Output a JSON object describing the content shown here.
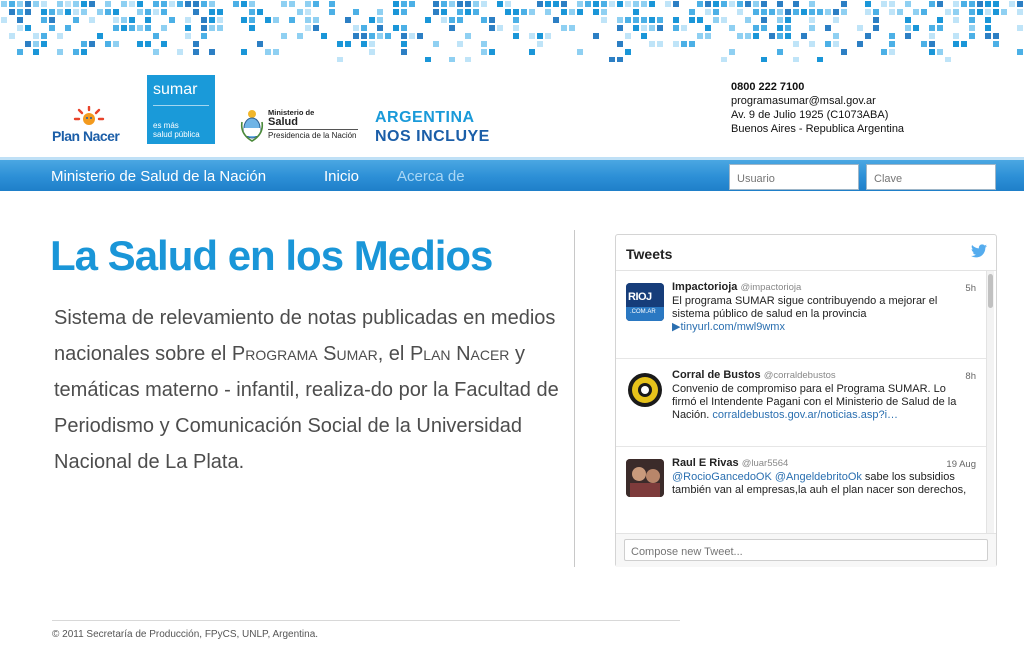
{
  "logos": {
    "plan_nacer": "Plan Nacer",
    "sumar": {
      "word": "sumar",
      "tag_line1": "es más",
      "tag_line2": "salud pública"
    },
    "ministerio": {
      "line1": "Ministerio de",
      "line2": "Salud",
      "line3": "Presidencia de la Nación"
    },
    "argentina": {
      "line1": "ARGENTINA",
      "line2": "NOS INCLUYE"
    }
  },
  "contact": {
    "phone": "0800 222 7100",
    "email": "programasumar@msal.gov.ar",
    "address": "Av. 9 de Julio 1925 (C1073ABA)",
    "city": "Buenos Aires - Republica Argentina"
  },
  "nav": {
    "brand": "Ministerio de Salud de la Nación",
    "items": [
      {
        "label": "Inicio",
        "state": "normal"
      },
      {
        "label": "Acerca de",
        "state": "muted"
      }
    ],
    "login": {
      "user_placeholder": "Usuario",
      "pass_placeholder": "Clave"
    }
  },
  "main": {
    "headline": "La Salud en los Medios",
    "description": {
      "p1": "Sistema de relevamiento de notas publicadas en medios nacionales sobre el ",
      "sc1": "Programa Sumar",
      "p2": ", el ",
      "sc2": "Plan Nacer",
      "p3": " y temáticas materno - infantil, realiza-do por la Facultad de Periodismo y Comunicación Social de la Universidad Nacional de La Plata."
    }
  },
  "tweets_widget": {
    "title": "Tweets",
    "compose_placeholder": "Compose new Tweet...",
    "tweets": [
      {
        "name": "Impactorioja",
        "handle": "@impactorioja",
        "time": "5h",
        "text": "El programa SUMAR sigue contribuyendo a mejorar el sistema público de salud en la provincia",
        "link": "▶tinyurl.com/mwl9wmx",
        "avatar_text": "RIOJ",
        "avatar_sub": ".COM.AR"
      },
      {
        "name": "Corral de Bustos",
        "handle": "@corraldebustos",
        "time": "8h",
        "text": "Convenio de compromiso para el Programa SUMAR. Lo firmó el Intendente Pagani con el Ministerio de Salud de la Nación. ",
        "link": "corraldebustos.gov.ar/noticias.asp?i…"
      },
      {
        "name": "Raul E Rivas",
        "handle": "@luar5564",
        "time": "19 Aug",
        "mention": "@RocioGancedoOK @AngeldebritoOk",
        "text": " sabe los subsidios también van al empresas,la auh el plan nacer son derechos,"
      }
    ]
  },
  "footer": {
    "copyright": "© 2011 Secretaría de Producción, FPyCS, UNLP, Argentina."
  },
  "colors": {
    "accent_blue": "#1a96d8",
    "nav_blue": "#2c8fd6",
    "brand_dark_blue": "#1b5ea8"
  }
}
